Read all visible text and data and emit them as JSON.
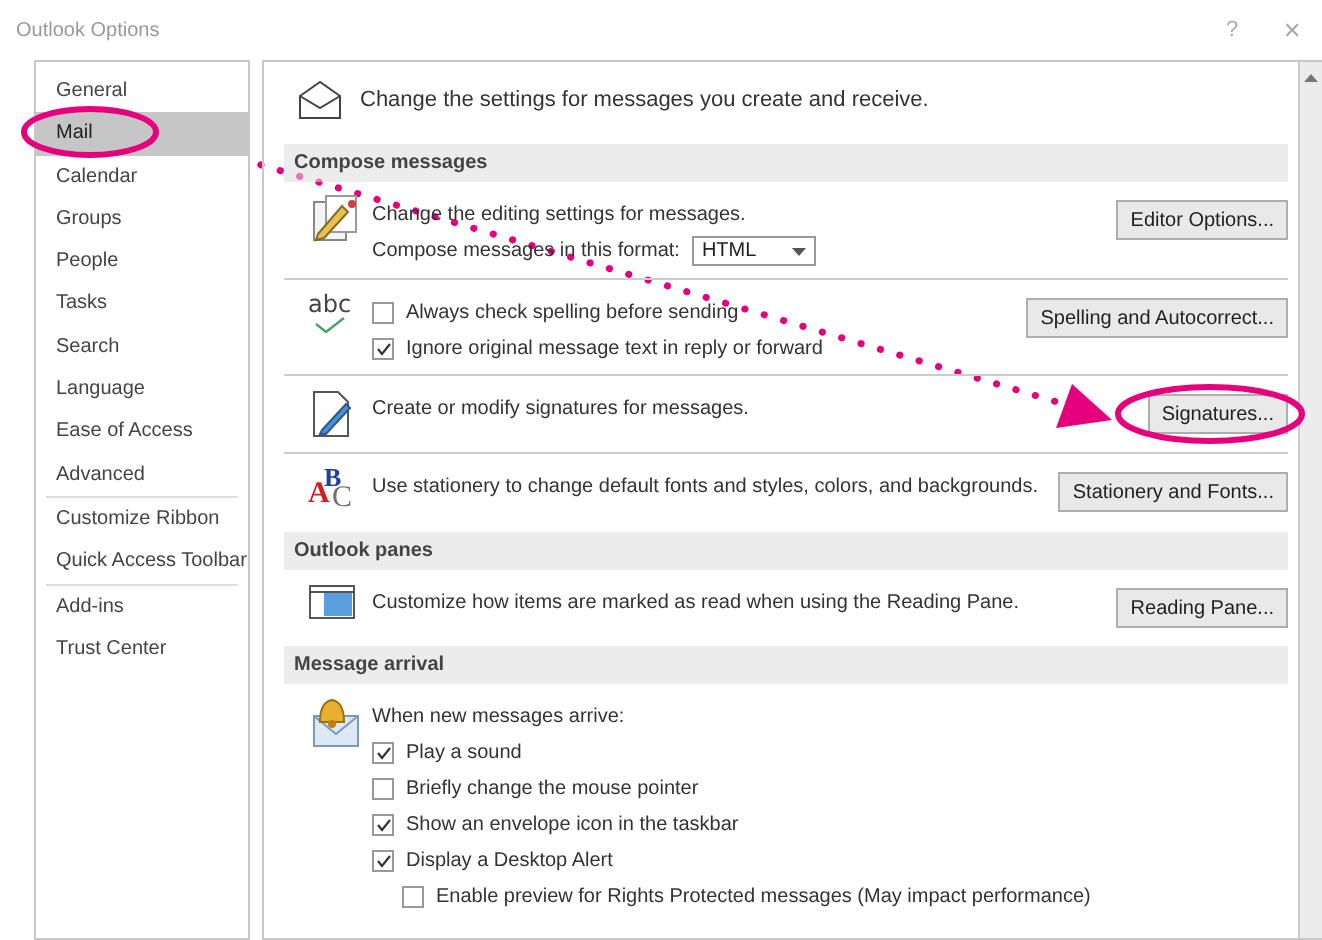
{
  "window": {
    "title": "Outlook Options",
    "help": "?",
    "close": "✕"
  },
  "sidebar": {
    "groups": [
      {
        "items": [
          {
            "label": "General",
            "selected": false
          },
          {
            "label": "Mail",
            "selected": true
          },
          {
            "label": "Calendar",
            "selected": false
          },
          {
            "label": "Groups",
            "selected": false
          },
          {
            "label": "People",
            "selected": false
          },
          {
            "label": "Tasks",
            "selected": false
          },
          {
            "label": "Search",
            "selected": false
          },
          {
            "label": "Language",
            "selected": false
          },
          {
            "label": "Ease of Access",
            "selected": false
          },
          {
            "label": "Advanced",
            "selected": false
          }
        ]
      },
      {
        "items": [
          {
            "label": "Customize Ribbon",
            "selected": false
          },
          {
            "label": "Quick Access Toolbar",
            "selected": false
          }
        ]
      },
      {
        "items": [
          {
            "label": "Add-ins",
            "selected": false
          },
          {
            "label": "Trust Center",
            "selected": false
          }
        ]
      }
    ]
  },
  "intro": "Change the settings for messages you create and receive.",
  "sections": [
    {
      "title": "Compose messages",
      "rows": [
        {
          "button": "Editor Options...",
          "lines": [
            {
              "kind": "text",
              "text": "Change the editing settings for messages."
            },
            {
              "kind": "select",
              "label": "Compose messages in this format:",
              "value": "HTML"
            }
          ]
        },
        {
          "icon_text": "abc",
          "button": "Spelling and Autocorrect...",
          "lines": [
            {
              "kind": "checkbox",
              "label": "Always check spelling before sending",
              "checked": false
            },
            {
              "kind": "checkbox",
              "label": "Ignore original message text in reply or forward",
              "checked": true
            }
          ]
        },
        {
          "button": "Signatures...",
          "lines": [
            {
              "kind": "text",
              "text": "Create or modify signatures for messages."
            }
          ]
        },
        {
          "icon_text": "ABC",
          "button": "Stationery and Fonts...",
          "lines": [
            {
              "kind": "text",
              "text": "Use stationery to change default fonts and styles, colors, and backgrounds."
            }
          ]
        }
      ]
    },
    {
      "title": "Outlook panes",
      "rows": [
        {
          "button": "Reading Pane...",
          "lines": [
            {
              "kind": "text",
              "text": "Customize how items are marked as read when using the Reading Pane."
            }
          ]
        }
      ]
    },
    {
      "title": "Message arrival",
      "rows": [
        {
          "lines": [
            {
              "kind": "text",
              "text": "When new messages arrive:"
            },
            {
              "kind": "checkbox",
              "label": "Play a sound",
              "checked": true
            },
            {
              "kind": "checkbox",
              "label": "Briefly change the mouse pointer",
              "checked": false
            },
            {
              "kind": "checkbox",
              "label": "Show an envelope icon in the taskbar",
              "checked": true
            },
            {
              "kind": "checkbox",
              "label": "Display a Desktop Alert",
              "checked": true,
              "children": [
                {
                  "kind": "checkbox",
                  "label": "Enable preview for Rights Protected messages (May impact performance)",
                  "checked": false
                }
              ]
            }
          ]
        }
      ]
    }
  ]
}
